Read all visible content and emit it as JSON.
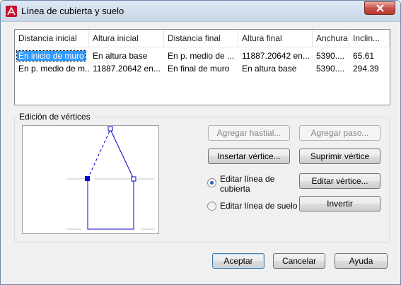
{
  "window": {
    "title": "Línea de cubierta y suelo"
  },
  "list": {
    "columns": [
      "Distancia inicial",
      "Altura inicial",
      "Distancia final",
      "Altura final",
      "Anchura",
      "Inclin..."
    ],
    "rows": [
      [
        "En inicio de muro",
        "En altura base",
        "En p. medio de ...",
        "11887.20642 en...",
        "5390....",
        "65.61"
      ],
      [
        "En p. medio de m...",
        "11887.20642 en...",
        "En final de muro",
        "En altura base",
        "5390....",
        "294.39"
      ]
    ],
    "selected_row": 0
  },
  "vertex_edit": {
    "group_label": "Edición de vértices",
    "add_gable_label": "Agregar hastial...",
    "add_step_label": "Agregar paso...",
    "insert_vertex_label": "Insertar vértice...",
    "delete_vertex_label": "Suprimir vértice",
    "edit_vertex_label": "Editar vértice...",
    "invert_label": "Invertir",
    "radio_roof_label_1": "Editar línea de",
    "radio_roof_label_2": "cubierta",
    "radio_floor_label": "Editar línea de suelo",
    "selected_mode": "roof"
  },
  "footer": {
    "accept_label": "Aceptar",
    "cancel_label": "Cancelar",
    "help_label": "Ayuda"
  },
  "colors": {
    "accent": "#3399ff",
    "preview_line": "#0000cc",
    "app_icon": "#c8102e"
  }
}
